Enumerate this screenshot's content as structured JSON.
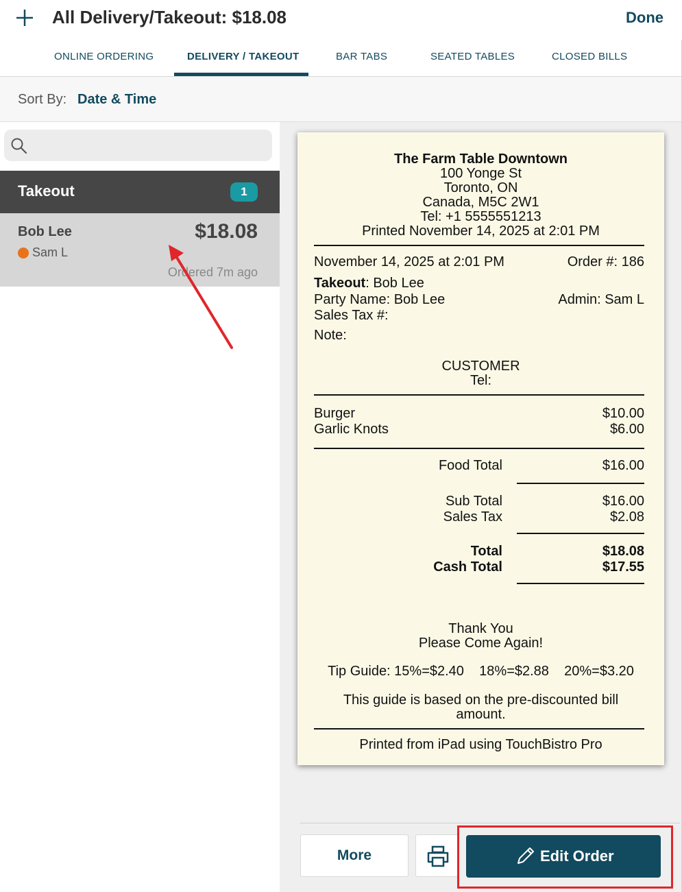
{
  "header": {
    "title": "All Delivery/Takeout: $18.08",
    "done_label": "Done"
  },
  "tabs": [
    {
      "label": "ONLINE ORDERING"
    },
    {
      "label": "DELIVERY / TAKEOUT",
      "active": true
    },
    {
      "label": "BAR TABS"
    },
    {
      "label": "SEATED TABLES"
    },
    {
      "label": "CLOSED BILLS"
    }
  ],
  "sort": {
    "label": "Sort By:",
    "value": "Date & Time"
  },
  "search": {
    "placeholder": ""
  },
  "group": {
    "title": "Takeout",
    "count": "1"
  },
  "order": {
    "name": "Bob Lee",
    "total": "$18.08",
    "server": "Sam L",
    "time": "Ordered 7m ago",
    "status_color": "#e8731c"
  },
  "receipt": {
    "restaurant": "The Farm Table Downtown",
    "address1": "100 Yonge St",
    "address2": "Toronto, ON",
    "address3": "Canada, M5C 2W1",
    "tel": "Tel: +1 5555551213",
    "printed": "Printed November 14, 2025 at 2:01 PM",
    "datetime": "November 14, 2025 at 2:01 PM",
    "order_number": "Order #: 186",
    "type_label": "Takeout",
    "type_value": ": Bob Lee",
    "party": "Party Name: Bob Lee",
    "admin": "Admin: Sam L",
    "sales_tax_no": "Sales Tax #:",
    "note": "Note:",
    "customer": "CUSTOMER",
    "customer_tel": "Tel:",
    "items": [
      {
        "name": "Burger",
        "price": "$10.00"
      },
      {
        "name": "Garlic Knots",
        "price": "$6.00"
      }
    ],
    "food_total_label": "Food Total",
    "food_total": "$16.00",
    "sub_total_label": "Sub Total",
    "sub_total": "$16.00",
    "sales_tax_label": "Sales Tax",
    "sales_tax": "$2.08",
    "total_label": "Total",
    "total": "$18.08",
    "cash_total_label": "Cash Total",
    "cash_total": "$17.55",
    "thanks1": "Thank You",
    "thanks2": "Please Come Again!",
    "tip_guide": "Tip Guide: 15%=$2.40    18%=$2.88    20%=$3.20",
    "guide_note1": "This guide is based on the pre-discounted bill",
    "guide_note2": "amount.",
    "footer": "Printed from iPad using TouchBistro Pro"
  },
  "actions": {
    "more_label": "More",
    "edit_label": "Edit Order"
  },
  "icons": {
    "plus": "plus-icon",
    "search": "search-icon",
    "printer": "printer-icon",
    "pencil": "pencil-icon"
  },
  "colors": {
    "brand": "#124a5f",
    "badge": "#1a9aa3",
    "annotation": "#e0262b"
  }
}
